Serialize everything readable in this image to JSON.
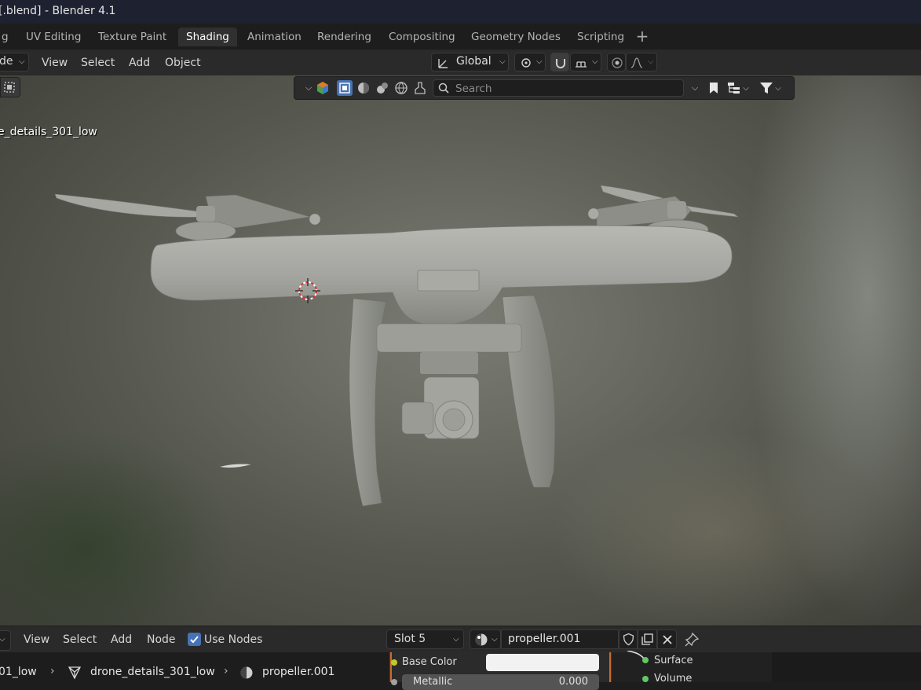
{
  "window": {
    "title": "[.blend] - Blender 4.1"
  },
  "tabs": [
    {
      "label": "g"
    },
    {
      "label": "UV Editing"
    },
    {
      "label": "Texture Paint"
    },
    {
      "label": "Shading",
      "active": true
    },
    {
      "label": "Animation"
    },
    {
      "label": "Rendering"
    },
    {
      "label": "Compositing"
    },
    {
      "label": "Geometry Nodes"
    },
    {
      "label": "Scripting"
    }
  ],
  "viewport_header": {
    "mode_label": "de",
    "menus": [
      "View",
      "Select",
      "Add",
      "Object"
    ],
    "transform_orientation": "Global"
  },
  "viewport": {
    "search_placeholder": "Search",
    "object_label": "e_details_301_low"
  },
  "node_editor": {
    "menus": [
      "View",
      "Select",
      "Add",
      "Node"
    ],
    "use_nodes_label": "Use Nodes",
    "use_nodes_checked": true,
    "slot": "Slot 5",
    "material_name": "propeller.001",
    "breadcrumb": [
      "01_low",
      "drone_details_301_low",
      "propeller.001"
    ],
    "node_fields": {
      "base_color_label": "Base Color",
      "base_color_value": "#f2f2f2",
      "metallic_label": "Metallic",
      "metallic_value": "0.000"
    },
    "output_sockets": [
      "Surface",
      "Volume"
    ]
  },
  "colors": {
    "accent": "#4772b3",
    "socket_green": "#63c763",
    "socket_yellow": "#c7c729"
  }
}
